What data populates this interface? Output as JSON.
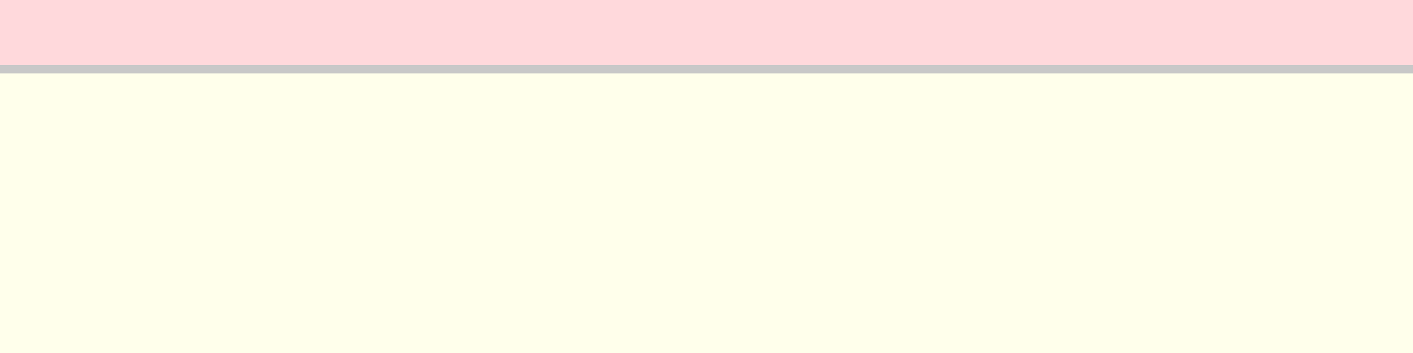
{
  "colors": {
    "top_panel": "#ffd9dc",
    "divider": "#c8c8c8",
    "content_area": "#ffffeb"
  }
}
